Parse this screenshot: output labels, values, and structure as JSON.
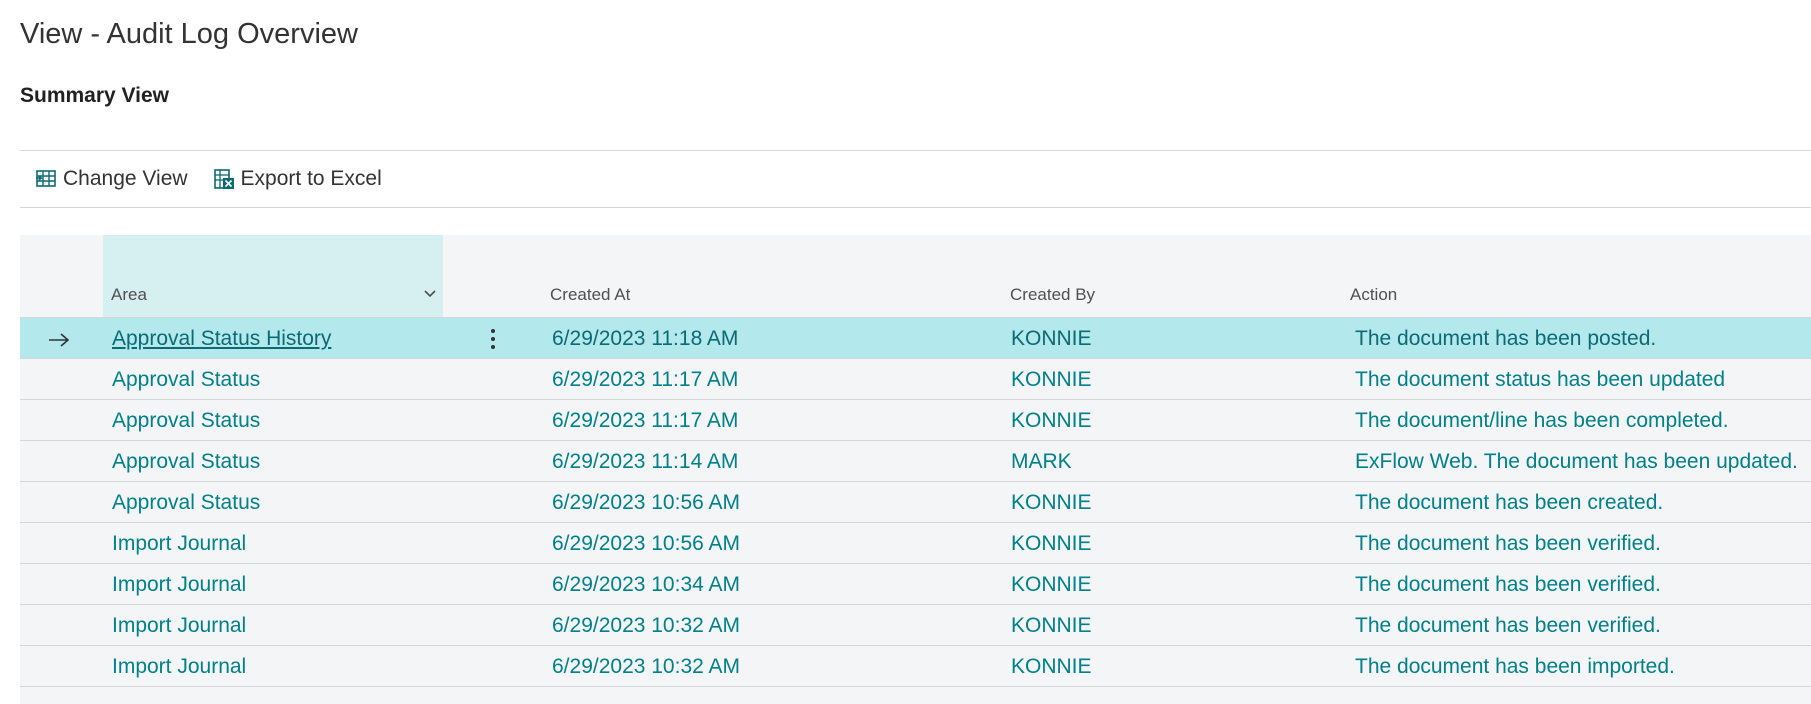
{
  "page": {
    "title": "View - Audit Log Overview",
    "subtitle": "Summary View"
  },
  "actions": {
    "change_view": "Change View",
    "export_excel": "Export to Excel"
  },
  "table": {
    "headers": {
      "area": "Area",
      "created_at": "Created At",
      "created_by": "Created By",
      "action": "Action"
    },
    "rows": [
      {
        "area": "Approval Status History",
        "created_at": "6/29/2023 11:18 AM",
        "created_by": "KONNIE",
        "action": "The document has been posted."
      },
      {
        "area": "Approval Status",
        "created_at": "6/29/2023 11:17 AM",
        "created_by": "KONNIE",
        "action": "The document status has been updated"
      },
      {
        "area": "Approval Status",
        "created_at": "6/29/2023 11:17 AM",
        "created_by": "KONNIE",
        "action": "The document/line has been completed."
      },
      {
        "area": "Approval Status",
        "created_at": "6/29/2023 11:14 AM",
        "created_by": "MARK",
        "action": "ExFlow Web. The document has been updated."
      },
      {
        "area": "Approval Status",
        "created_at": "6/29/2023 10:56 AM",
        "created_by": "KONNIE",
        "action": "The document has been created."
      },
      {
        "area": "Import Journal",
        "created_at": "6/29/2023 10:56 AM",
        "created_by": "KONNIE",
        "action": "The document has been verified."
      },
      {
        "area": "Import Journal",
        "created_at": "6/29/2023 10:34 AM",
        "created_by": "KONNIE",
        "action": "The document has been verified."
      },
      {
        "area": "Import Journal",
        "created_at": "6/29/2023 10:32 AM",
        "created_by": "KONNIE",
        "action": "The document has been verified."
      },
      {
        "area": "Import Journal",
        "created_at": "6/29/2023 10:32 AM",
        "created_by": "KONNIE",
        "action": "The document has been imported."
      }
    ]
  },
  "icons": {
    "change_view": "change-view-icon",
    "export_excel": "excel-icon",
    "sort": "chevron-down-icon",
    "row_selected": "arrow-right-icon",
    "row_menu": "more-vertical-icon"
  },
  "colors": {
    "accent": "#00808a",
    "selected_row": "#b3e8ec",
    "header_highlight": "#d6eff1",
    "grid_bg": "#f4f5f6"
  }
}
